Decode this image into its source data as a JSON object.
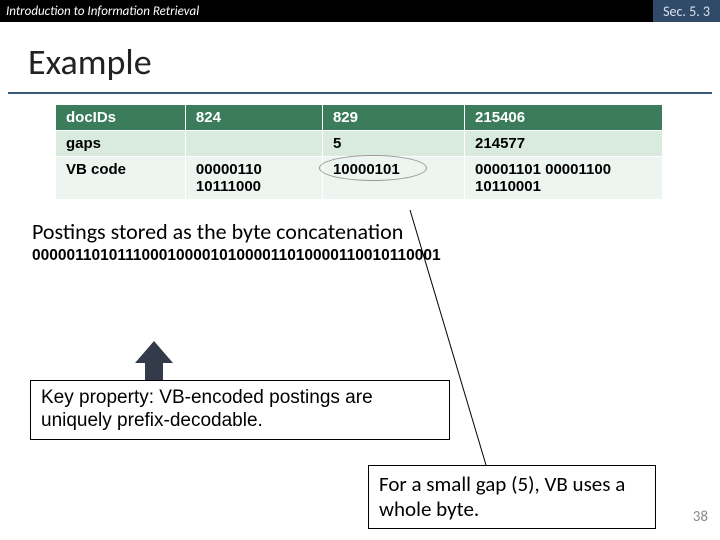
{
  "topbar": {
    "left": "Introduction to Information Retrieval",
    "right": "Sec. 5. 3"
  },
  "title": "Example",
  "table": {
    "h": {
      "c0": "docIDs",
      "c1": "824",
      "c2": "829",
      "c3": "215406"
    },
    "g": {
      "c0": "gaps",
      "c1": "",
      "c2": "5",
      "c3": "214577"
    },
    "v": {
      "c0": "VB code",
      "c1": "00000110 10111000",
      "c2": "10000101",
      "c3": "00001101 00001100 10110001"
    }
  },
  "sentence": "Postings stored as the byte concatenation",
  "bytestring": "000001101011100010000101000011010000110010110001",
  "box1": "Key property: VB-encoded postings are uniquely prefix-decodable.",
  "box2": "For a small gap (5), VB uses a whole byte.",
  "pagenum": "38"
}
